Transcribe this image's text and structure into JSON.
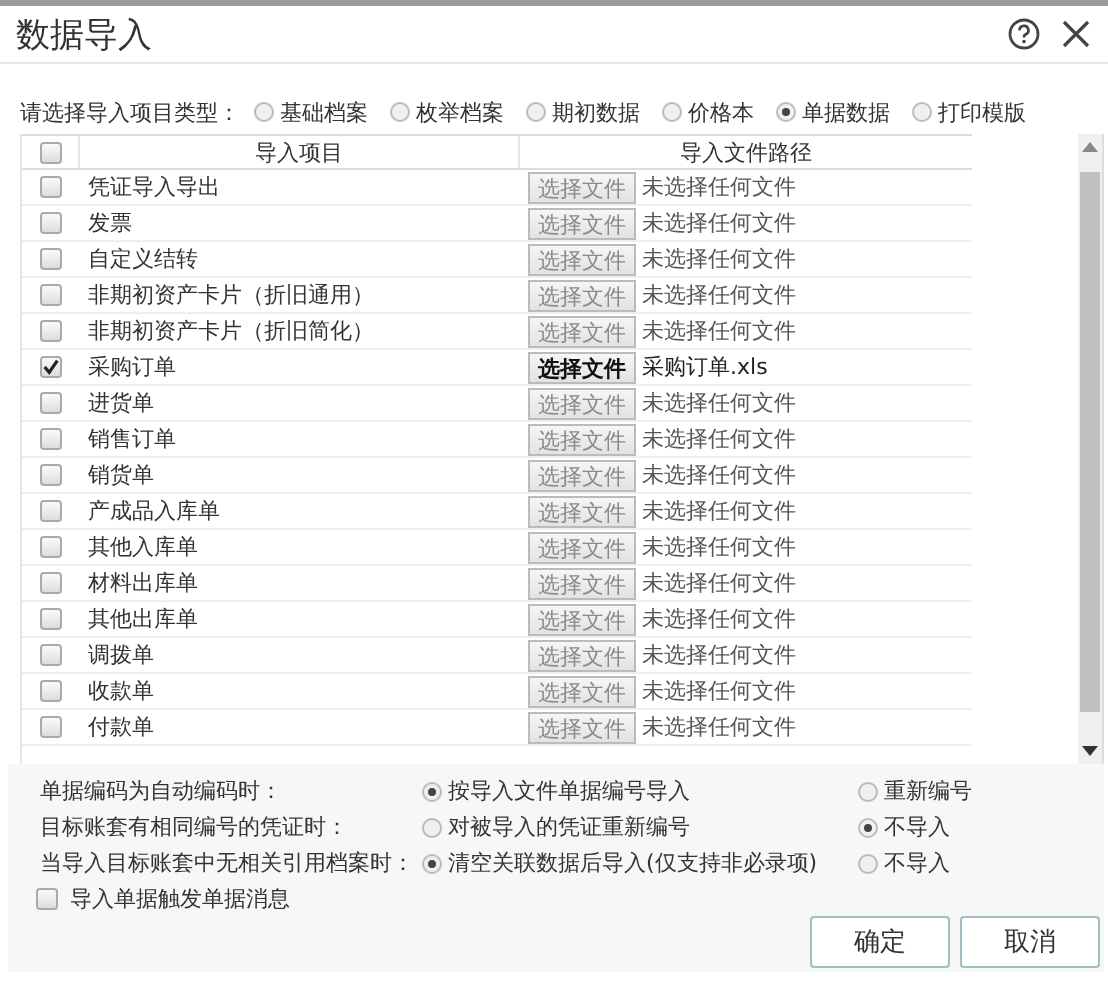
{
  "window": {
    "title": "数据导入"
  },
  "type_selector": {
    "label": "请选择导入项目类型：",
    "options": [
      {
        "label": "基础档案",
        "selected": false
      },
      {
        "label": "枚举档案",
        "selected": false
      },
      {
        "label": "期初数据",
        "selected": false
      },
      {
        "label": "价格本",
        "selected": false
      },
      {
        "label": "单据数据",
        "selected": true
      },
      {
        "label": "打印模版",
        "selected": false
      }
    ]
  },
  "table": {
    "select_all_checked": false,
    "columns": [
      "导入项目",
      "导入文件路径"
    ],
    "rows": [
      {
        "name": "凭证导入导出",
        "checked": false,
        "button": "选择文件",
        "file": "未选择任何文件"
      },
      {
        "name": "发票",
        "checked": false,
        "button": "选择文件",
        "file": "未选择任何文件"
      },
      {
        "name": "自定义结转",
        "checked": false,
        "button": "选择文件",
        "file": "未选择任何文件"
      },
      {
        "name": "非期初资产卡片（折旧通用）",
        "checked": false,
        "button": "选择文件",
        "file": "未选择任何文件"
      },
      {
        "name": "非期初资产卡片（折旧简化）",
        "checked": false,
        "button": "选择文件",
        "file": "未选择任何文件"
      },
      {
        "name": "采购订单",
        "checked": true,
        "button": "选择文件",
        "file": "采购订单.xls"
      },
      {
        "name": "进货单",
        "checked": false,
        "button": "选择文件",
        "file": "未选择任何文件"
      },
      {
        "name": "销售订单",
        "checked": false,
        "button": "选择文件",
        "file": "未选择任何文件"
      },
      {
        "name": "销货单",
        "checked": false,
        "button": "选择文件",
        "file": "未选择任何文件"
      },
      {
        "name": "产成品入库单",
        "checked": false,
        "button": "选择文件",
        "file": "未选择任何文件"
      },
      {
        "name": "其他入库单",
        "checked": false,
        "button": "选择文件",
        "file": "未选择任何文件"
      },
      {
        "name": "材料出库单",
        "checked": false,
        "button": "选择文件",
        "file": "未选择任何文件"
      },
      {
        "name": "其他出库单",
        "checked": false,
        "button": "选择文件",
        "file": "未选择任何文件"
      },
      {
        "name": "调拨单",
        "checked": false,
        "button": "选择文件",
        "file": "未选择任何文件"
      },
      {
        "name": "收款单",
        "checked": false,
        "button": "选择文件",
        "file": "未选择任何文件"
      },
      {
        "name": "付款单",
        "checked": false,
        "button": "选择文件",
        "file": "未选择任何文件"
      }
    ]
  },
  "options": [
    {
      "label": "单据编码为自动编码时：",
      "choices": [
        {
          "label": "按导入文件单据编号导入",
          "selected": true
        },
        {
          "label": "重新编号",
          "selected": false
        }
      ]
    },
    {
      "label": "目标账套有相同编号的凭证时：",
      "choices": [
        {
          "label": "对被导入的凭证重新编号",
          "selected": false
        },
        {
          "label": "不导入",
          "selected": true
        }
      ]
    },
    {
      "label": "当导入目标账套中无相关引用档案时：",
      "choices": [
        {
          "label": "清空关联数据后导入(仅支持非必录项)",
          "selected": true
        },
        {
          "label": "不导入",
          "selected": false
        }
      ]
    }
  ],
  "notify": {
    "label": "导入单据触发单据消息",
    "checked": false
  },
  "buttons": [
    "确定",
    "取消"
  ]
}
